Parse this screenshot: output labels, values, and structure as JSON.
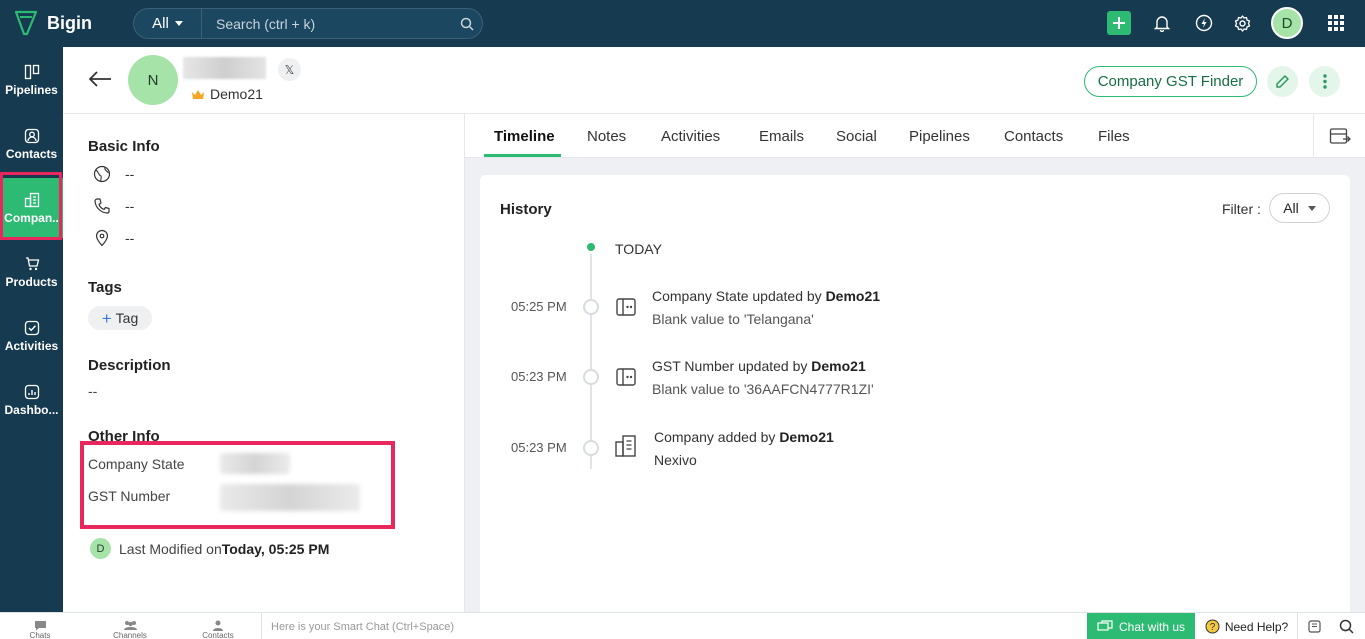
{
  "app": {
    "name": "Bigin"
  },
  "search": {
    "scope": "All",
    "placeholder": "Search (ctrl + k)"
  },
  "user": {
    "initial": "D"
  },
  "nav": {
    "items": [
      {
        "label": "Pipelines",
        "icon": "pipelines-icon"
      },
      {
        "label": "Contacts",
        "icon": "contacts-icon"
      },
      {
        "label": "Compan..",
        "icon": "companies-icon",
        "active": true
      },
      {
        "label": "Products",
        "icon": "products-icon"
      },
      {
        "label": "Activities",
        "icon": "activities-icon"
      },
      {
        "label": "Dashbo...",
        "icon": "dashboards-icon"
      }
    ]
  },
  "record": {
    "avatar_initial": "N",
    "x_label": "𝕏",
    "owner": "Demo21",
    "gst_finder_label": "Company GST Finder"
  },
  "left": {
    "basic_info_title": "Basic Info",
    "website": "--",
    "phone": "--",
    "address": "--",
    "tags_title": "Tags",
    "tag_button": "Tag",
    "description_title": "Description",
    "description_value": "--",
    "other_info_title": "Other Info",
    "company_state_label": "Company State",
    "gst_number_label": "GST Number",
    "modified_avatar": "D",
    "modified_prefix": "Last Modified on",
    "modified_time": "Today, 05:25 PM"
  },
  "tabs": [
    "Timeline",
    "Notes",
    "Activities",
    "Emails",
    "Social",
    "Pipelines",
    "Contacts",
    "Files"
  ],
  "history": {
    "title": "History",
    "filter_label": "Filter :",
    "filter_value": "All",
    "today_label": "TODAY",
    "entries": [
      {
        "time": "05:25 PM",
        "action": "Company State updated by ",
        "user": "Demo21",
        "detail": "Blank value to 'Telangana'"
      },
      {
        "time": "05:23 PM",
        "action": "GST Number updated by ",
        "user": "Demo21",
        "detail": "Blank value to '36AAFCN4777R1ZI'"
      },
      {
        "time": "05:23 PM",
        "action": "Company added by ",
        "user": "Demo21",
        "detail": "Nexivo"
      }
    ]
  },
  "bottom": {
    "chats": "Chats",
    "channels": "Channels",
    "contacts": "Contacts",
    "smart_chat_placeholder": "Here is your Smart Chat (Ctrl+Space)",
    "chat_with_us": "Chat with us",
    "need_help": "Need Help?"
  },
  "colors": {
    "brand": "#2dbb73",
    "topbar": "#163a50",
    "highlight": "#e8275d"
  }
}
